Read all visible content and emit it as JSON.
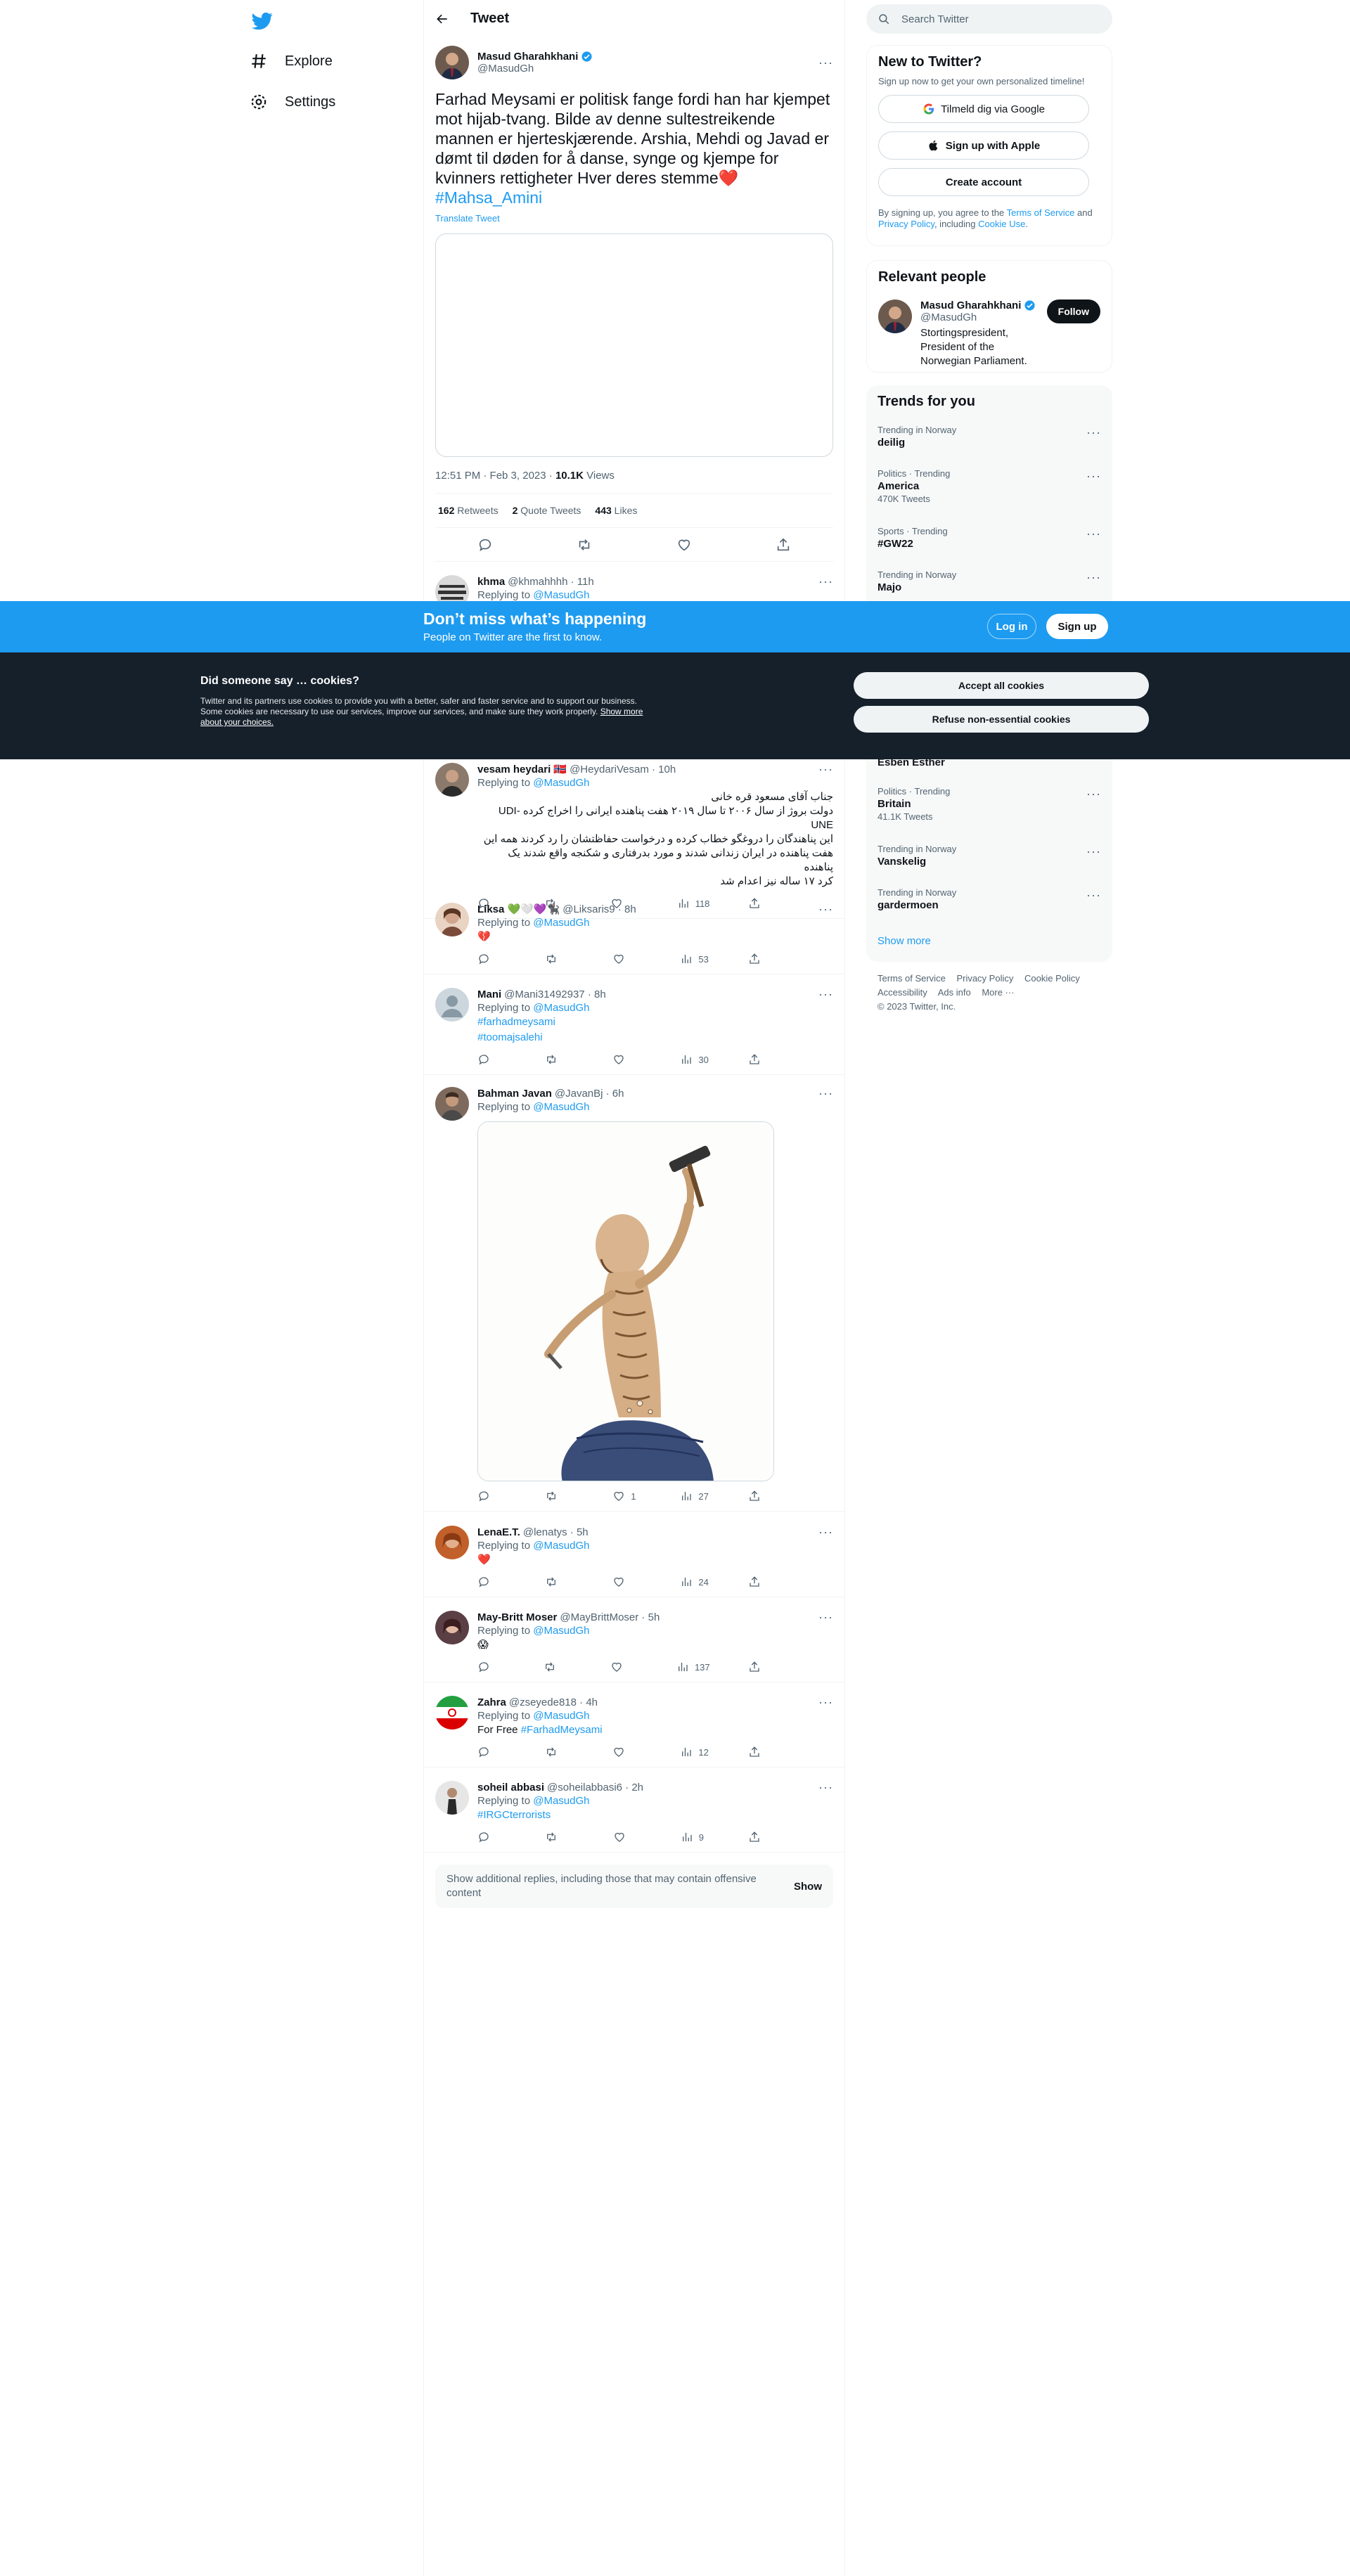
{
  "nav": {
    "explore_label": "Explore",
    "settings_label": "Settings"
  },
  "header": {
    "title": "Tweet"
  },
  "tweet": {
    "author_name": "Masud Gharahkhani",
    "author_handle": "@MasudGh",
    "text": "Farhad Meysami er politisk fange fordi han har kjempet mot hijab-tvang. Bilde av denne sultestreikende mannen er hjerteskjærende. Arshia, Mehdi og Javad er dømt til døden for å danse, synge og kjempe for kvinners rettigheter  Hver deres stemme",
    "emoji": "❤️",
    "hashtag": "#Mahsa_Amini",
    "translate": "Translate Tweet",
    "time": "12:51 PM · Feb 3, 2023 · ",
    "views_count": "10.1K",
    "views_label": " Views",
    "retweets_count": "162",
    "retweets_label": " Retweets",
    "quotes_count": "2",
    "quotes_label": " Quote Tweets",
    "likes_count": "443",
    "likes_label": " Likes"
  },
  "replying_prefix": "Replying to ",
  "replies": [
    {
      "name": "khma",
      "handle": "@khmahhhh · 11h",
      "replying_to": "@MasudGh"
    },
    {
      "name": "vesam heydari 🇳🇴",
      "handle": "@HeydariVesam · 10h",
      "replying_to": "@MasudGh",
      "text_rtl": "جناب آقای مسعود قره خانی\nدولت بروژ از سال ۲۰۰۶ تا سال ۲۰۱۹ هفت پناهنده ایرانی را اخراج کرده UDI-UNE\nاین پناهندگان را دروغگو خطاب کرده و درخواست حفاظتشان را رد کردند همه این\nهفت پناهنده در ایران زندانی شدند و مورد بدرفتاری و شکنجه واقع شدند یک پناهنده\nکرد ۱۷ ساله نیز اعدام شد",
      "views": "118"
    },
    {
      "name": "Liksa 💚🤍💜🐈‍⬛",
      "handle": "@Liksaris9 · 8h",
      "replying_to": "@MasudGh",
      "text": "💔",
      "views": "53"
    },
    {
      "name": "Mani",
      "handle": "@Mani31492937 · 8h",
      "replying_to": "@MasudGh",
      "tag1": "#farhadmeysami",
      "tag2": "#toomajsalehi",
      "views": "30"
    },
    {
      "name": "Bahman Javan",
      "handle": "@JavanBj · 6h",
      "replying_to": "@MasudGh",
      "likes": "1",
      "views": "27"
    },
    {
      "name": "LenaE.T.",
      "handle": "@lenatys · 5h",
      "replying_to": "@MasudGh",
      "text": "❤️",
      "views": "24"
    },
    {
      "name": "May-Britt Moser",
      "handle": "@MayBrittMoser · 5h",
      "replying_to": "@MasudGh",
      "text": "😱",
      "views": "137"
    },
    {
      "name": "Zahra",
      "handle": "@zseyede818 · 4h",
      "replying_to": "@MasudGh",
      "text": "For Free ",
      "tag": "#FarhadMeysami",
      "views": "12"
    },
    {
      "name": "soheil abbasi",
      "handle": "@soheilabbasi6 · 2h",
      "replying_to": "@MasudGh",
      "tag": "#IRGCterrorists",
      "views": "9"
    }
  ],
  "show_more": {
    "text": "Show additional replies, including those that may contain offensive content",
    "button": "Show"
  },
  "search": {
    "placeholder": "Search Twitter"
  },
  "signup": {
    "title": "New to Twitter?",
    "subtitle": "Sign up now to get your own personalized timeline!",
    "google": "Tilmeld dig via Google",
    "apple": "Sign up with Apple",
    "create": "Create account",
    "legal_1": "By signing up, you agree to the ",
    "tos": "Terms of Service",
    "legal_2": " and ",
    "privacy": "Privacy Policy",
    "legal_3": ", including ",
    "cookie": "Cookie Use",
    "legal_4": "."
  },
  "relevant": {
    "title": "Relevant people",
    "name": "Masud Gharahkhani",
    "handle": "@MasudGh",
    "follow": "Follow",
    "bio": "Stortingspresident, President of the Norwegian Parliament."
  },
  "trends": {
    "title": "Trends for you",
    "items": [
      {
        "context": "Trending in Norway",
        "topic": "deilig",
        "count": ""
      },
      {
        "context": "Politics · Trending",
        "topic": "America",
        "count": "470K Tweets"
      },
      {
        "context": "Sports · Trending",
        "topic": "#GW22",
        "count": ""
      },
      {
        "context": "Trending in Norway",
        "topic": "Majo",
        "count": ""
      },
      {
        "context": "",
        "topic": "Esben Esther",
        "count": ""
      },
      {
        "context": "Politics · Trending",
        "topic": "Britain",
        "count": "41.1K Tweets"
      },
      {
        "context": "Trending in Norway",
        "topic": "Vanskelig",
        "count": ""
      },
      {
        "context": "Trending in Norway",
        "topic": "gardermoen",
        "count": ""
      }
    ],
    "show_more": "Show more"
  },
  "footer": {
    "tos": "Terms of Service",
    "privacy": "Privacy Policy",
    "cookie": "Cookie Policy",
    "accessibility": "Accessibility",
    "ads": "Ads info",
    "more": "More ···",
    "copyright": "© 2023 Twitter, Inc."
  },
  "banner": {
    "title": "Don’t miss what’s happening",
    "subtitle": "People on Twitter are the first to know.",
    "login": "Log in",
    "signup": "Sign up"
  },
  "cookies": {
    "title": "Did someone say … cookies?",
    "body": "Twitter and its partners use cookies to provide you with a better, safer and faster service and to support our business. Some cookies are necessary to use our services, improve our services, and make sure they work properly. ",
    "link": "Show more about your choices.",
    "accept": "Accept all cookies",
    "refuse": "Refuse non-essential cookies"
  },
  "colors": {
    "accent": "#1d9bf0",
    "banner_bg": "#1d9bf0",
    "cookie_bg": "#15202b",
    "heart": "#e0245e"
  }
}
